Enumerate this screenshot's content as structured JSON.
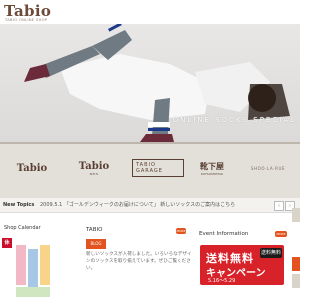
{
  "header": {
    "logo": "Tabio",
    "logo_sub": "TABIO ONLINE SHOP"
  },
  "hero": {
    "caption": "ONLINE SOCKS SPECIAL"
  },
  "brands": {
    "b1": "Tabio",
    "b2": "Tabio",
    "b2_sub": "MEN",
    "b3": "TABIO GARAGE",
    "b4": "靴下屋",
    "b4_sub": "KUTSUSHITAYA",
    "b5": "SHOO·LA·RUE"
  },
  "ticker": {
    "label": "New Topics",
    "text": "2009.5.1 「ゴールデンウィークのお届けについて」 新しいソックスのご案内はこちら",
    "prev": "‹",
    "next": "›"
  },
  "calendar": {
    "title": "Shop Calendar",
    "red_label": "休"
  },
  "blog": {
    "title": "TABIO",
    "more": "MORE",
    "icon": "BLOG",
    "body": "新しいソックスが入荷しました。いろいろなデザインのソックスを取り揃えています。ぜひご覧ください。"
  },
  "event": {
    "title": "Event Information",
    "more": "MORE",
    "banner_big": "送料無料",
    "banner_camp": "キャンペーン",
    "banner_dates": "5.16～5.29",
    "banner_badge": "送料無料"
  },
  "colors": {
    "accent": "#e2531f",
    "red": "#d8222a",
    "brown": "#5a4032"
  }
}
